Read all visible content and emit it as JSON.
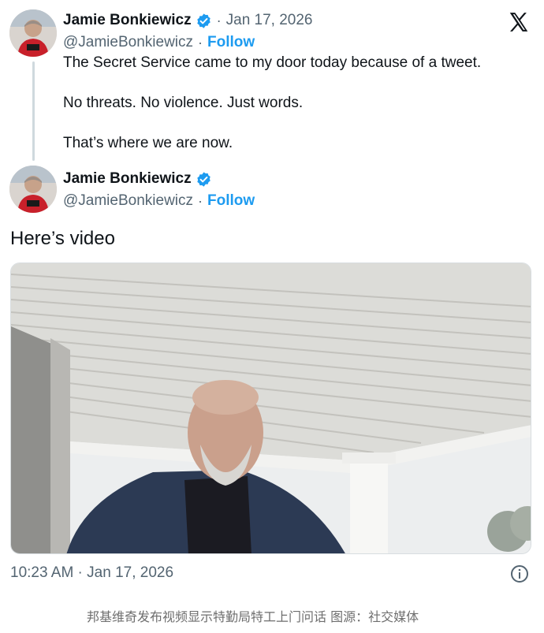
{
  "tweet1": {
    "name": "Jamie Bonkiewicz",
    "date": "Jan 17, 2026",
    "handle": "@JamieBonkiewicz",
    "follow": "Follow",
    "lines": [
      "The Secret Service came to my door today because of a tweet.",
      "No threats. No violence. Just words.",
      "That’s where we are now."
    ]
  },
  "tweet2": {
    "name": "Jamie Bonkiewicz",
    "handle": "@JamieBonkiewicz",
    "follow": "Follow",
    "text": "Here’s video"
  },
  "footer": {
    "timestamp": "10:23 AM · Jan 17, 2026"
  },
  "caption": "邦基维奇发布视频显示特勤局特工上门问话    图源：社交媒体",
  "icons": {
    "verified": "verified-badge-icon",
    "brand": "x-logo-icon",
    "info": "info-icon"
  },
  "colors": {
    "accent": "#1d9bf0",
    "secondary_text": "#536471",
    "primary_text": "#0f1419"
  }
}
